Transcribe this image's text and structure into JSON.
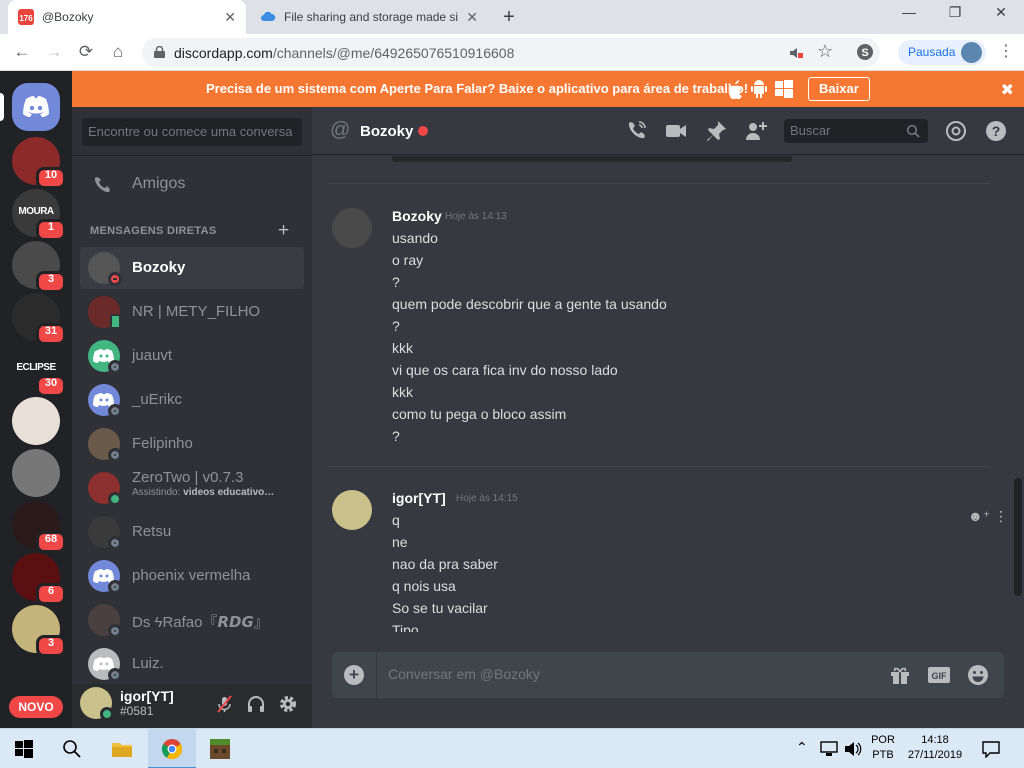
{
  "browser": {
    "tabs": [
      {
        "title": "@Bozoky",
        "favicon_badge": "176"
      },
      {
        "title": "File sharing and storage made si"
      }
    ],
    "url_host": "discordapp.com",
    "url_path": "/channels/@me/649265076510916608",
    "profile_label": "Pausada"
  },
  "banner": {
    "message": "Precisa de um sistema com Aperte Para Falar? Baixe o aplicativo para área de trabalho!",
    "download_label": "Baixar"
  },
  "servers": [
    {
      "badge": "10",
      "color": "#8c2a2a"
    },
    {
      "badge": "1",
      "color": "#3a3a3a",
      "label": "MOURA"
    },
    {
      "badge": "3",
      "color": "#4a4a4a"
    },
    {
      "badge": "31",
      "color": "#2b2b2b"
    },
    {
      "badge": "30",
      "color": "#202225",
      "label": "ECLIPSE"
    },
    {
      "badge": "",
      "color": "#e8e0d6"
    },
    {
      "badge": "",
      "color": "#777777"
    },
    {
      "badge": "68",
      "color": "#2a1a1a"
    },
    {
      "badge": "6",
      "color": "#5a1010"
    },
    {
      "badge": "3",
      "color": "#c4b37a"
    }
  ],
  "new_label": "NOVO",
  "sidebar": {
    "search_placeholder": "Encontre ou comece uma conversa",
    "friends_label": "Amigos",
    "dm_header": "MENSAGENS DIRETAS",
    "dms": [
      {
        "name": "Bozoky",
        "status": "dnd",
        "avatar": "#555555"
      },
      {
        "name": "NR | METY_FILHO",
        "status": "mobile",
        "avatar": "#6b2b2b"
      },
      {
        "name": "juauvt",
        "status": "offline",
        "avatar": "#43b581",
        "default": true
      },
      {
        "name": "_uErikc",
        "status": "offline",
        "avatar": "#7289da",
        "default": true
      },
      {
        "name": "Felipinho",
        "status": "offline",
        "avatar": "#6a5a4a"
      },
      {
        "name": "ZeroTwo | v0.7.3",
        "status": "online",
        "avatar": "#8c3030",
        "activity_prefix": "Assistindo:",
        "activity": "videos educativo…"
      },
      {
        "name": "Retsu",
        "status": "offline",
        "avatar": "#3a3a3a"
      },
      {
        "name": "phoenix vermelha",
        "status": "offline",
        "avatar": "#7289da",
        "default": true
      },
      {
        "name": "Ds ϟRafao『𝙍𝘿𝙂』",
        "status": "offline",
        "avatar": "#4a4040"
      },
      {
        "name": "Luiz.",
        "status": "offline",
        "avatar": "#b9bbbe",
        "default": true
      }
    ]
  },
  "user": {
    "name": "igor[YT]",
    "tag": "#0581"
  },
  "chat": {
    "recipient": "Bozoky",
    "search_placeholder": "Buscar",
    "composer_placeholder": "Conversar em @Bozoky",
    "messages": [
      {
        "author": "Bozoky",
        "time": "Hoje às 14:13",
        "avatar": "#4a4a4a",
        "lines": [
          "usando",
          "o ray",
          "?",
          "quem pode descobrir que a gente ta usando",
          "?",
          "kkk",
          "vi que os cara fica inv do nosso lado",
          "kkk",
          "como tu pega o bloco assim",
          "?"
        ]
      },
      {
        "author": "igor[YT]",
        "time": "Hoje às 14:15",
        "avatar": "#c9c08b",
        "lines": [
          "q",
          "ne",
          "nao da pra saber",
          "q nois usa",
          "So se tu vacilar",
          "Tipo"
        ]
      }
    ]
  },
  "taskbar": {
    "lang": "POR",
    "layout": "PTB",
    "time": "14:18",
    "date": "27/11/2019"
  }
}
